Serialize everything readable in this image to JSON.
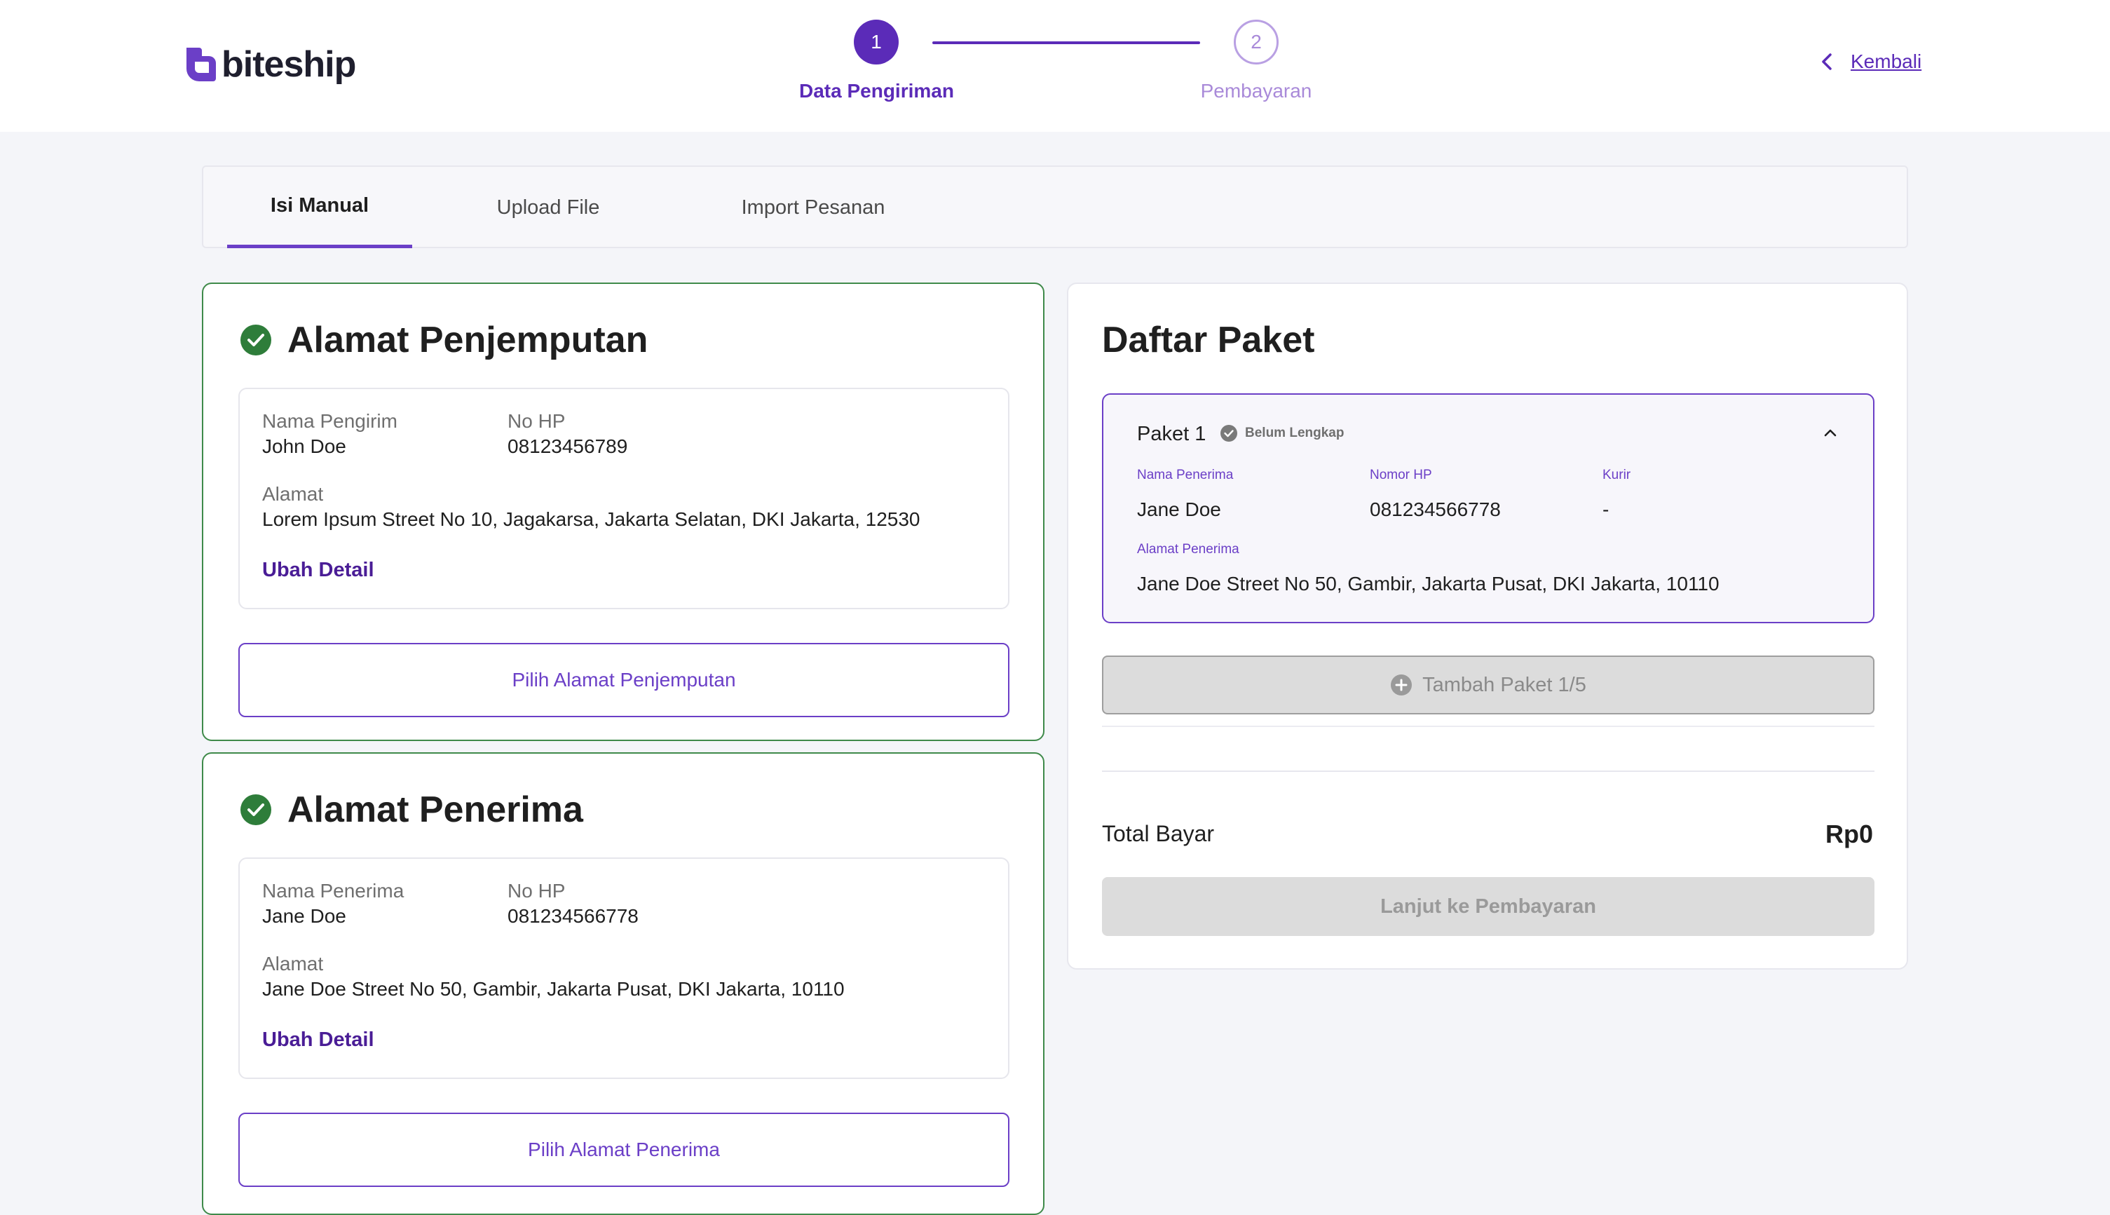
{
  "brand": {
    "name": "biteship",
    "color": "#5b2bb8"
  },
  "stepper": {
    "steps": [
      {
        "number": "1",
        "label": "Data Pengiriman",
        "state": "active"
      },
      {
        "number": "2",
        "label": "Pembayaran",
        "state": "upcoming"
      }
    ]
  },
  "header": {
    "back_label": "Kembali"
  },
  "tabs": [
    "Isi Manual",
    "Upload File",
    "Import Pesanan"
  ],
  "pickup": {
    "title": "Alamat Penjemputan",
    "name_label": "Nama Pengirim",
    "name": "John Doe",
    "phone_label": "No HP",
    "phone": "08123456789",
    "address_label": "Alamat",
    "address": "Lorem Ipsum Street No 10, Jagakarsa, Jakarta Selatan, DKI Jakarta, 12530",
    "edit_label": "Ubah Detail",
    "select_button": "Pilih Alamat Penjemputan"
  },
  "receiver": {
    "title": "Alamat Penerima",
    "name_label": "Nama Penerima",
    "name": "Jane Doe",
    "phone_label": "No HP",
    "phone": "081234566778",
    "address_label": "Alamat",
    "address": "Jane Doe Street No 50, Gambir, Jakarta Pusat, DKI Jakarta, 10110",
    "edit_label": "Ubah Detail",
    "select_button": "Pilih Alamat Penerima"
  },
  "packages": {
    "title": "Daftar Paket",
    "items": [
      {
        "name": "Paket 1",
        "status": "Belum Lengkap",
        "receiver_label": "Nama Penerima",
        "receiver": "Jane Doe",
        "phone_label": "Nomor HP",
        "phone": "081234566778",
        "courier_label": "Kurir",
        "courier": "-",
        "address_label": "Alamat Penerima",
        "address": "Jane Doe Street No 50, Gambir, Jakarta Pusat, DKI Jakarta, 10110"
      }
    ],
    "add_button": "Tambah Paket 1/5",
    "total_label": "Total Bayar",
    "total_value": "Rp0",
    "pay_button": "Lanjut ke Pembayaran"
  },
  "colors": {
    "primary": "#5b2bb8",
    "success_border": "#3f8a4a",
    "success_icon": "#2e7d3a",
    "disabled": "#dcdcdc"
  }
}
